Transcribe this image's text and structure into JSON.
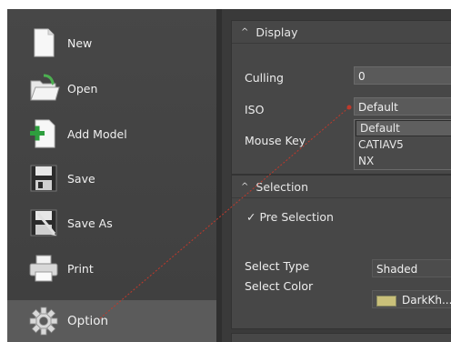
{
  "menu": {
    "items": [
      {
        "label": "New"
      },
      {
        "label": "Open"
      },
      {
        "label": "Add Model"
      },
      {
        "label": "Save"
      },
      {
        "label": "Save As"
      },
      {
        "label": "Print"
      },
      {
        "label": "Option"
      }
    ]
  },
  "display": {
    "title": "Display",
    "culling_label": "Culling",
    "culling_value": "0",
    "iso_label": "ISO",
    "iso_value": "Default",
    "mouse_key_label": "Mouse Key",
    "iso_options": [
      "Default",
      "CATIAV5",
      "NX"
    ]
  },
  "selection": {
    "title": "Selection",
    "pre_selection": "Pre Selection",
    "select_type_label": "Select Type",
    "select_type_value": "Shaded",
    "select_color_label": "Select Color",
    "select_color_value": "DarkKh..."
  },
  "colors": {
    "accent_line": "#c0392b",
    "swatch": "#c9c07a"
  }
}
